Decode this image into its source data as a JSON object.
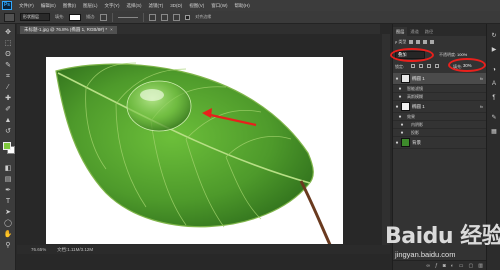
{
  "app": {
    "logo": "Ps"
  },
  "menu": [
    "文件(F)",
    "编辑(E)",
    "图像(I)",
    "图层(L)",
    "文字(Y)",
    "选择(S)",
    "滤镜(T)",
    "3D(D)",
    "视图(V)",
    "窗口(W)",
    "帮助(H)"
  ],
  "options": {
    "mode_value": "形状图层",
    "fill_label": "填充:",
    "stroke_label": "描边:",
    "align_label": "对齐边缘"
  },
  "document": {
    "tab_label": "未标题-1.jpg @ 76.8% (椭圆 1, RGB/8#) *",
    "close_glyph": "×",
    "zoom": "76.65%",
    "doc_size": "文档:1.11M/3.12M"
  },
  "layers_panel": {
    "tabs": [
      "图层",
      "通道",
      "路径"
    ],
    "filter_kind": "ρ 类型",
    "blend_mode": "叠加",
    "opacity_label": "不透明度:",
    "opacity_value": "100%",
    "lock_label": "锁定:",
    "fill_label": "填充:",
    "fill_value": "30%",
    "layers": [
      {
        "name": "椭圆 1",
        "fx": "fx",
        "thumb": "#e6e6e6",
        "selected": true
      },
      {
        "name": "智能滤镜",
        "sub": true
      },
      {
        "name": "高斯模糊",
        "sub": true
      },
      {
        "name": "椭圆 1",
        "fx": "fx",
        "thumb": "#f0f0f0",
        "selected": false
      },
      {
        "name": "效果",
        "sub": true
      },
      {
        "name": "内阴影",
        "sub": true
      },
      {
        "name": "投影",
        "sub": true
      },
      {
        "name": "背景",
        "thumb": "#3d8a2b",
        "selected": false
      }
    ],
    "bottom_icons": [
      "link-icon",
      "fx-icon",
      "mask-icon",
      "adjustment-icon",
      "folder-icon",
      "new-layer-icon",
      "trash-icon"
    ]
  },
  "watermark": {
    "brand": "Baidu 经验",
    "url": "jingyan.baidu.com"
  },
  "colors": {
    "foreground": "#7fc93d",
    "background": "#ffffff",
    "annotation_red": "#e8201c",
    "leaf_green": "#4e9a2b"
  }
}
